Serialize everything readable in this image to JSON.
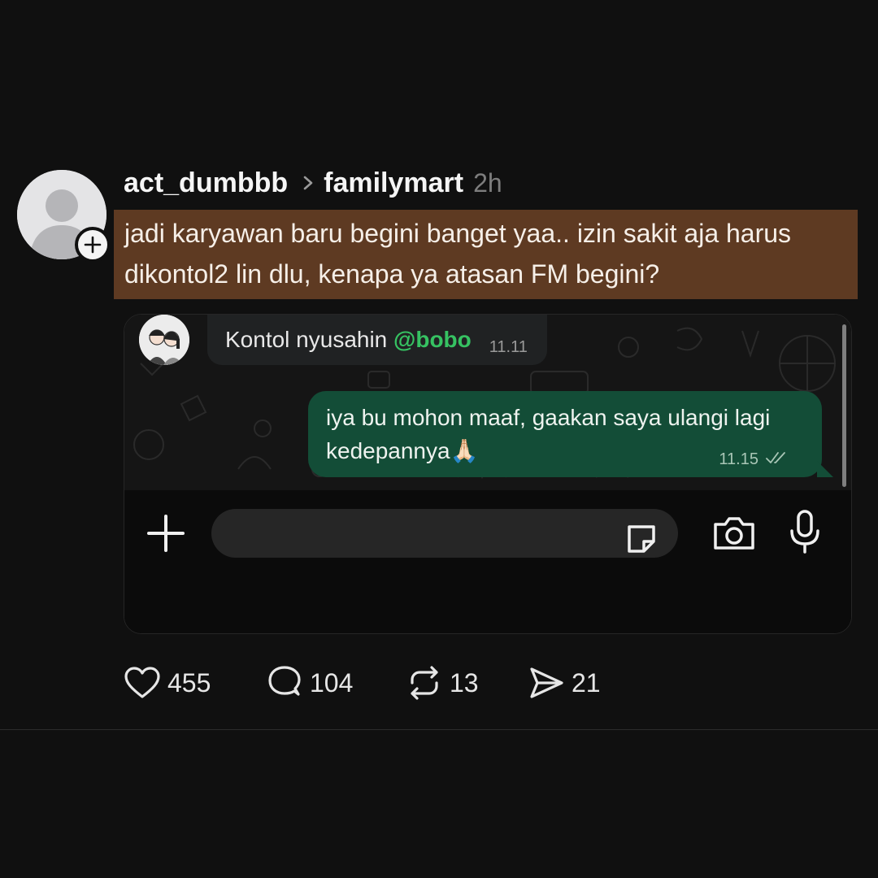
{
  "post": {
    "username": "act_dumbbb",
    "community": "familymart",
    "time": "2h",
    "caption": "jadi karyawan baru begini banget yaa.. izin sakit aja harus dikontol2 lin dlu, kenapa ya atasan FM begini?"
  },
  "chat": {
    "incoming": {
      "text": "Kontol nyusahin ",
      "mention": "@bobo",
      "time": "11.11"
    },
    "outgoing": {
      "text": "iya bu mohon maaf, gaakan saya ulangi lagi kedepannya🙏🏻",
      "time": "11.15"
    }
  },
  "actions": {
    "likes": "455",
    "replies": "104",
    "reposts": "13",
    "shares": "21"
  },
  "colors": {
    "background": "#101010",
    "caption_highlight": "#5e3a22",
    "outgoing_bubble": "#134d37",
    "mention": "#36c262"
  }
}
